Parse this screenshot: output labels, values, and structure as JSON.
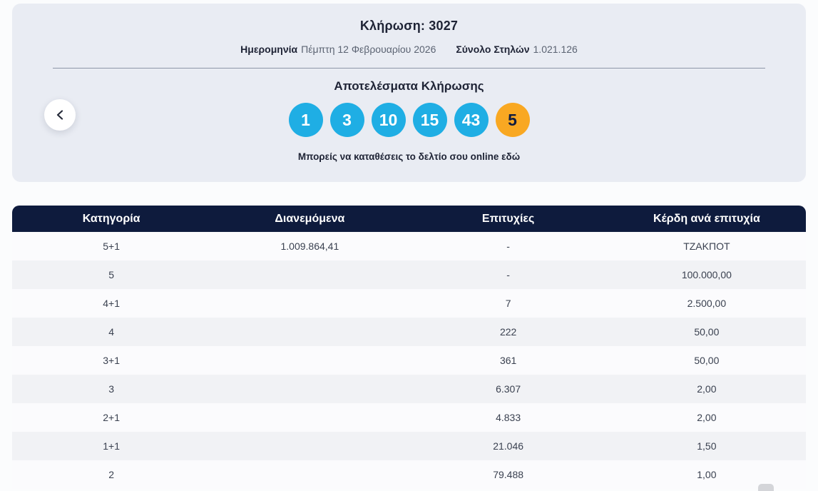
{
  "draw": {
    "title": "Κλήρωση: 3027",
    "date_label": "Ημερομηνία",
    "date_value": "Πέμπτη 12 Φεβρουαρίου 2026",
    "columns_label": "Σύνολο Στηλών",
    "columns_value": "1.021.126",
    "results_title": "Αποτελέσματα Κλήρωσης",
    "numbers": [
      "1",
      "3",
      "10",
      "15",
      "43"
    ],
    "joker": "5",
    "cta": "Μπορείς να καταθέσεις το δελτίο σου online εδώ"
  },
  "colors": {
    "ball_blue": "#1fა0e0",
    "ball_blue_hex": "#1faee4",
    "ball_joker": "#f9a822",
    "header_navy": "#0e1b3d",
    "card_bg": "#e9ecf3",
    "title_text": "#1e2335"
  },
  "table": {
    "headers": [
      "Κατηγορία",
      "Διανεμόμενα",
      "Επιτυχίες",
      "Κέρδη ανά επιτυχία"
    ],
    "rows": [
      {
        "category": "5+1",
        "distributed": "1.009.864,41",
        "winners": "-",
        "prize": "ΤΖΑΚΠΟΤ"
      },
      {
        "category": "5",
        "distributed": "",
        "winners": "-",
        "prize": "100.000,00"
      },
      {
        "category": "4+1",
        "distributed": "",
        "winners": "7",
        "prize": "2.500,00"
      },
      {
        "category": "4",
        "distributed": "",
        "winners": "222",
        "prize": "50,00"
      },
      {
        "category": "3+1",
        "distributed": "",
        "winners": "361",
        "prize": "50,00"
      },
      {
        "category": "3",
        "distributed": "",
        "winners": "6.307",
        "prize": "2,00"
      },
      {
        "category": "2+1",
        "distributed": "",
        "winners": "4.833",
        "prize": "2,00"
      },
      {
        "category": "1+1",
        "distributed": "",
        "winners": "21.046",
        "prize": "1,50"
      },
      {
        "category": "2",
        "distributed": "",
        "winners": "79.488",
        "prize": "1,00"
      }
    ]
  }
}
